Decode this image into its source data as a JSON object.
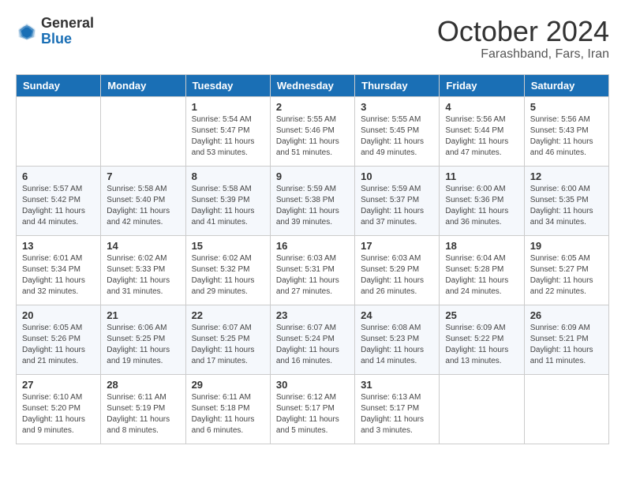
{
  "logo": {
    "general": "General",
    "blue": "Blue"
  },
  "header": {
    "month": "October 2024",
    "location": "Farashband, Fars, Iran"
  },
  "weekdays": [
    "Sunday",
    "Monday",
    "Tuesday",
    "Wednesday",
    "Thursday",
    "Friday",
    "Saturday"
  ],
  "weeks": [
    [
      {
        "day": "",
        "info": ""
      },
      {
        "day": "",
        "info": ""
      },
      {
        "day": "1",
        "info": "Sunrise: 5:54 AM\nSunset: 5:47 PM\nDaylight: 11 hours and 53 minutes."
      },
      {
        "day": "2",
        "info": "Sunrise: 5:55 AM\nSunset: 5:46 PM\nDaylight: 11 hours and 51 minutes."
      },
      {
        "day": "3",
        "info": "Sunrise: 5:55 AM\nSunset: 5:45 PM\nDaylight: 11 hours and 49 minutes."
      },
      {
        "day": "4",
        "info": "Sunrise: 5:56 AM\nSunset: 5:44 PM\nDaylight: 11 hours and 47 minutes."
      },
      {
        "day": "5",
        "info": "Sunrise: 5:56 AM\nSunset: 5:43 PM\nDaylight: 11 hours and 46 minutes."
      }
    ],
    [
      {
        "day": "6",
        "info": "Sunrise: 5:57 AM\nSunset: 5:42 PM\nDaylight: 11 hours and 44 minutes."
      },
      {
        "day": "7",
        "info": "Sunrise: 5:58 AM\nSunset: 5:40 PM\nDaylight: 11 hours and 42 minutes."
      },
      {
        "day": "8",
        "info": "Sunrise: 5:58 AM\nSunset: 5:39 PM\nDaylight: 11 hours and 41 minutes."
      },
      {
        "day": "9",
        "info": "Sunrise: 5:59 AM\nSunset: 5:38 PM\nDaylight: 11 hours and 39 minutes."
      },
      {
        "day": "10",
        "info": "Sunrise: 5:59 AM\nSunset: 5:37 PM\nDaylight: 11 hours and 37 minutes."
      },
      {
        "day": "11",
        "info": "Sunrise: 6:00 AM\nSunset: 5:36 PM\nDaylight: 11 hours and 36 minutes."
      },
      {
        "day": "12",
        "info": "Sunrise: 6:00 AM\nSunset: 5:35 PM\nDaylight: 11 hours and 34 minutes."
      }
    ],
    [
      {
        "day": "13",
        "info": "Sunrise: 6:01 AM\nSunset: 5:34 PM\nDaylight: 11 hours and 32 minutes."
      },
      {
        "day": "14",
        "info": "Sunrise: 6:02 AM\nSunset: 5:33 PM\nDaylight: 11 hours and 31 minutes."
      },
      {
        "day": "15",
        "info": "Sunrise: 6:02 AM\nSunset: 5:32 PM\nDaylight: 11 hours and 29 minutes."
      },
      {
        "day": "16",
        "info": "Sunrise: 6:03 AM\nSunset: 5:31 PM\nDaylight: 11 hours and 27 minutes."
      },
      {
        "day": "17",
        "info": "Sunrise: 6:03 AM\nSunset: 5:29 PM\nDaylight: 11 hours and 26 minutes."
      },
      {
        "day": "18",
        "info": "Sunrise: 6:04 AM\nSunset: 5:28 PM\nDaylight: 11 hours and 24 minutes."
      },
      {
        "day": "19",
        "info": "Sunrise: 6:05 AM\nSunset: 5:27 PM\nDaylight: 11 hours and 22 minutes."
      }
    ],
    [
      {
        "day": "20",
        "info": "Sunrise: 6:05 AM\nSunset: 5:26 PM\nDaylight: 11 hours and 21 minutes."
      },
      {
        "day": "21",
        "info": "Sunrise: 6:06 AM\nSunset: 5:25 PM\nDaylight: 11 hours and 19 minutes."
      },
      {
        "day": "22",
        "info": "Sunrise: 6:07 AM\nSunset: 5:25 PM\nDaylight: 11 hours and 17 minutes."
      },
      {
        "day": "23",
        "info": "Sunrise: 6:07 AM\nSunset: 5:24 PM\nDaylight: 11 hours and 16 minutes."
      },
      {
        "day": "24",
        "info": "Sunrise: 6:08 AM\nSunset: 5:23 PM\nDaylight: 11 hours and 14 minutes."
      },
      {
        "day": "25",
        "info": "Sunrise: 6:09 AM\nSunset: 5:22 PM\nDaylight: 11 hours and 13 minutes."
      },
      {
        "day": "26",
        "info": "Sunrise: 6:09 AM\nSunset: 5:21 PM\nDaylight: 11 hours and 11 minutes."
      }
    ],
    [
      {
        "day": "27",
        "info": "Sunrise: 6:10 AM\nSunset: 5:20 PM\nDaylight: 11 hours and 9 minutes."
      },
      {
        "day": "28",
        "info": "Sunrise: 6:11 AM\nSunset: 5:19 PM\nDaylight: 11 hours and 8 minutes."
      },
      {
        "day": "29",
        "info": "Sunrise: 6:11 AM\nSunset: 5:18 PM\nDaylight: 11 hours and 6 minutes."
      },
      {
        "day": "30",
        "info": "Sunrise: 6:12 AM\nSunset: 5:17 PM\nDaylight: 11 hours and 5 minutes."
      },
      {
        "day": "31",
        "info": "Sunrise: 6:13 AM\nSunset: 5:17 PM\nDaylight: 11 hours and 3 minutes."
      },
      {
        "day": "",
        "info": ""
      },
      {
        "day": "",
        "info": ""
      }
    ]
  ]
}
